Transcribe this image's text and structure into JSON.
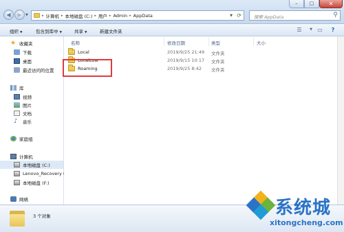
{
  "address": {
    "crumbs": [
      "计算机",
      "本地磁盘 (C:)",
      "用户",
      "Admin",
      "AppData"
    ]
  },
  "search": {
    "placeholder": "搜索 AppData"
  },
  "toolbar": {
    "organize": "组织",
    "include_in_library": "包含到库中",
    "share": "共享",
    "new_folder": "新建文件夹"
  },
  "sidebar": {
    "favorites": "收藏夹",
    "downloads": "下载",
    "desktop": "桌面",
    "recent": "最近访问的位置",
    "libraries": "库",
    "videos": "视频",
    "pictures": "图片",
    "documents": "文档",
    "music": "音乐",
    "homegroup": "家庭组",
    "computer": "计算机",
    "drive_c": "本地磁盘 (C:)",
    "lenovo_recovery": "Lenovo_Recovery (",
    "drive_f": "本地磁盘 (F:)",
    "network": "网络"
  },
  "columns": {
    "name": "名称",
    "modified": "修改日期",
    "type": "类型",
    "size": "大小"
  },
  "files": [
    {
      "name": "Local",
      "modified": "2019/9/25 21:49",
      "type": "文件夹",
      "size": ""
    },
    {
      "name": "LocalLow",
      "modified": "2019/9/15 10:17",
      "type": "文件夹",
      "size": ""
    },
    {
      "name": "Roaming",
      "modified": "2019/9/25 8:42",
      "type": "文件夹",
      "size": ""
    }
  ],
  "status": {
    "item_count": "3 个对象"
  },
  "watermark": {
    "brand": "系统城",
    "url": "xitongcheng.com"
  },
  "colors": {
    "highlight_box": "#e0393b",
    "watermark_blue": "#2a73c7"
  }
}
